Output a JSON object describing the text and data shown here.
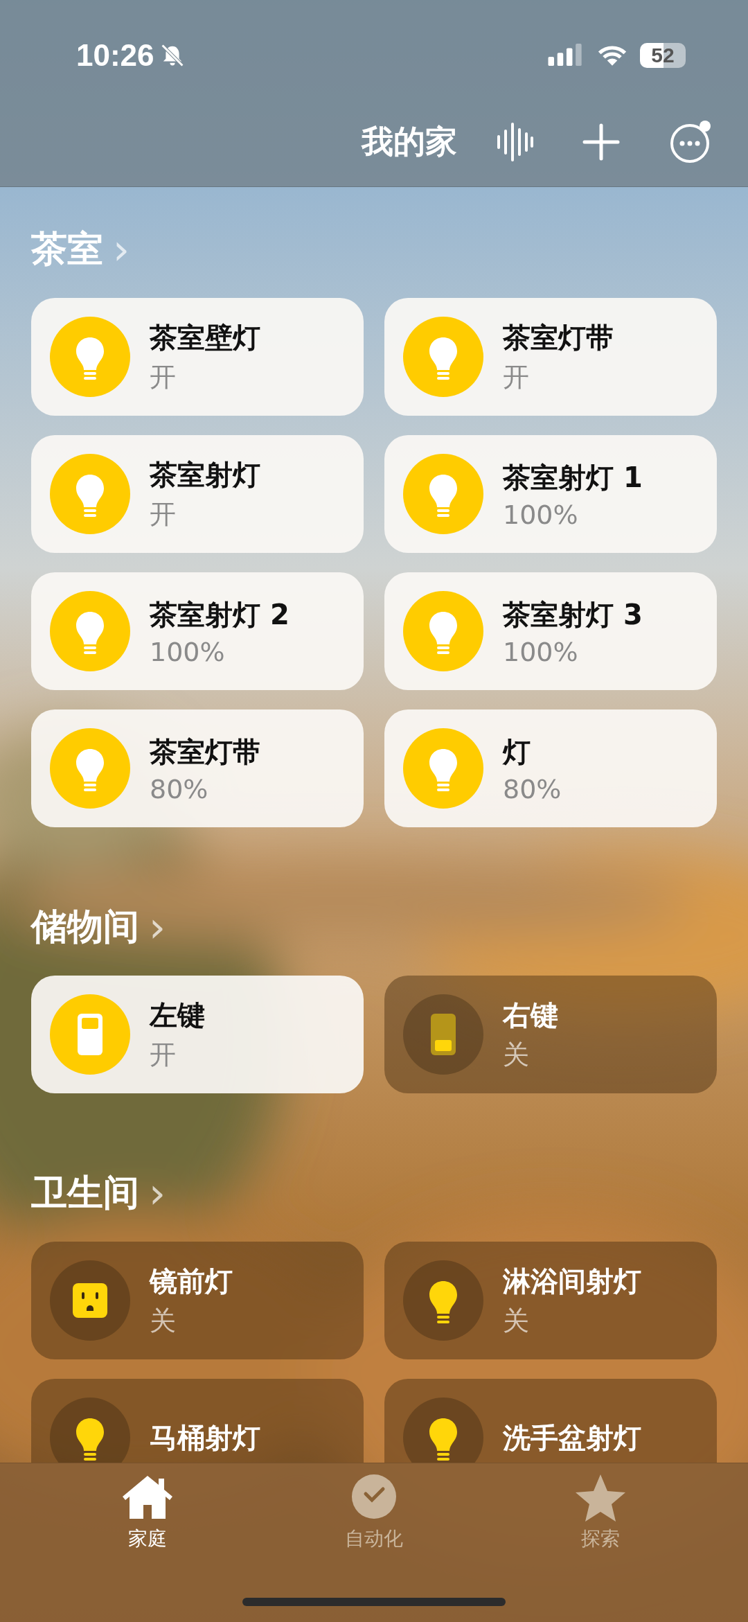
{
  "status_bar": {
    "time": "10:26",
    "battery": "52"
  },
  "header": {
    "title": "我的家"
  },
  "sections": [
    {
      "name": "茶室",
      "arrow": "›",
      "tiles": [
        {
          "name": "茶室壁灯",
          "status": "开",
          "kind": "light",
          "on": true
        },
        {
          "name": "茶室灯带",
          "status": "开",
          "kind": "light",
          "on": true
        },
        {
          "name": "茶室射灯",
          "status": "开",
          "kind": "light",
          "on": true
        },
        {
          "name": "茶室射灯 1",
          "status": "100%",
          "kind": "light",
          "on": true
        },
        {
          "name": "茶室射灯 2",
          "status": "100%",
          "kind": "light",
          "on": true
        },
        {
          "name": "茶室射灯 3",
          "status": "100%",
          "kind": "light",
          "on": true
        },
        {
          "name": "茶室灯带",
          "status": "80%",
          "kind": "light",
          "on": true
        },
        {
          "name": "灯",
          "status": "80%",
          "kind": "light",
          "on": true
        }
      ]
    },
    {
      "name": "储物间",
      "arrow": "›",
      "tiles": [
        {
          "name": "左键",
          "status": "开",
          "kind": "switch",
          "on": true
        },
        {
          "name": "右键",
          "status": "关",
          "kind": "switch",
          "on": false
        }
      ]
    },
    {
      "name": "卫生间",
      "arrow": "›",
      "tiles": [
        {
          "name": "镜前灯",
          "status": "关",
          "kind": "outlet",
          "on": false
        },
        {
          "name": "淋浴间射灯",
          "status": "关",
          "kind": "light",
          "on": false
        },
        {
          "name": "马桶射灯",
          "kind": "light",
          "on": false
        },
        {
          "name": "洗手盆射灯",
          "kind": "light",
          "on": false
        }
      ]
    }
  ],
  "tabs": [
    {
      "label": "家庭",
      "kind": "home",
      "selected": true
    },
    {
      "label": "自动化",
      "kind": "automation",
      "selected": false
    },
    {
      "label": "探索",
      "kind": "discover",
      "selected": false
    }
  ]
}
